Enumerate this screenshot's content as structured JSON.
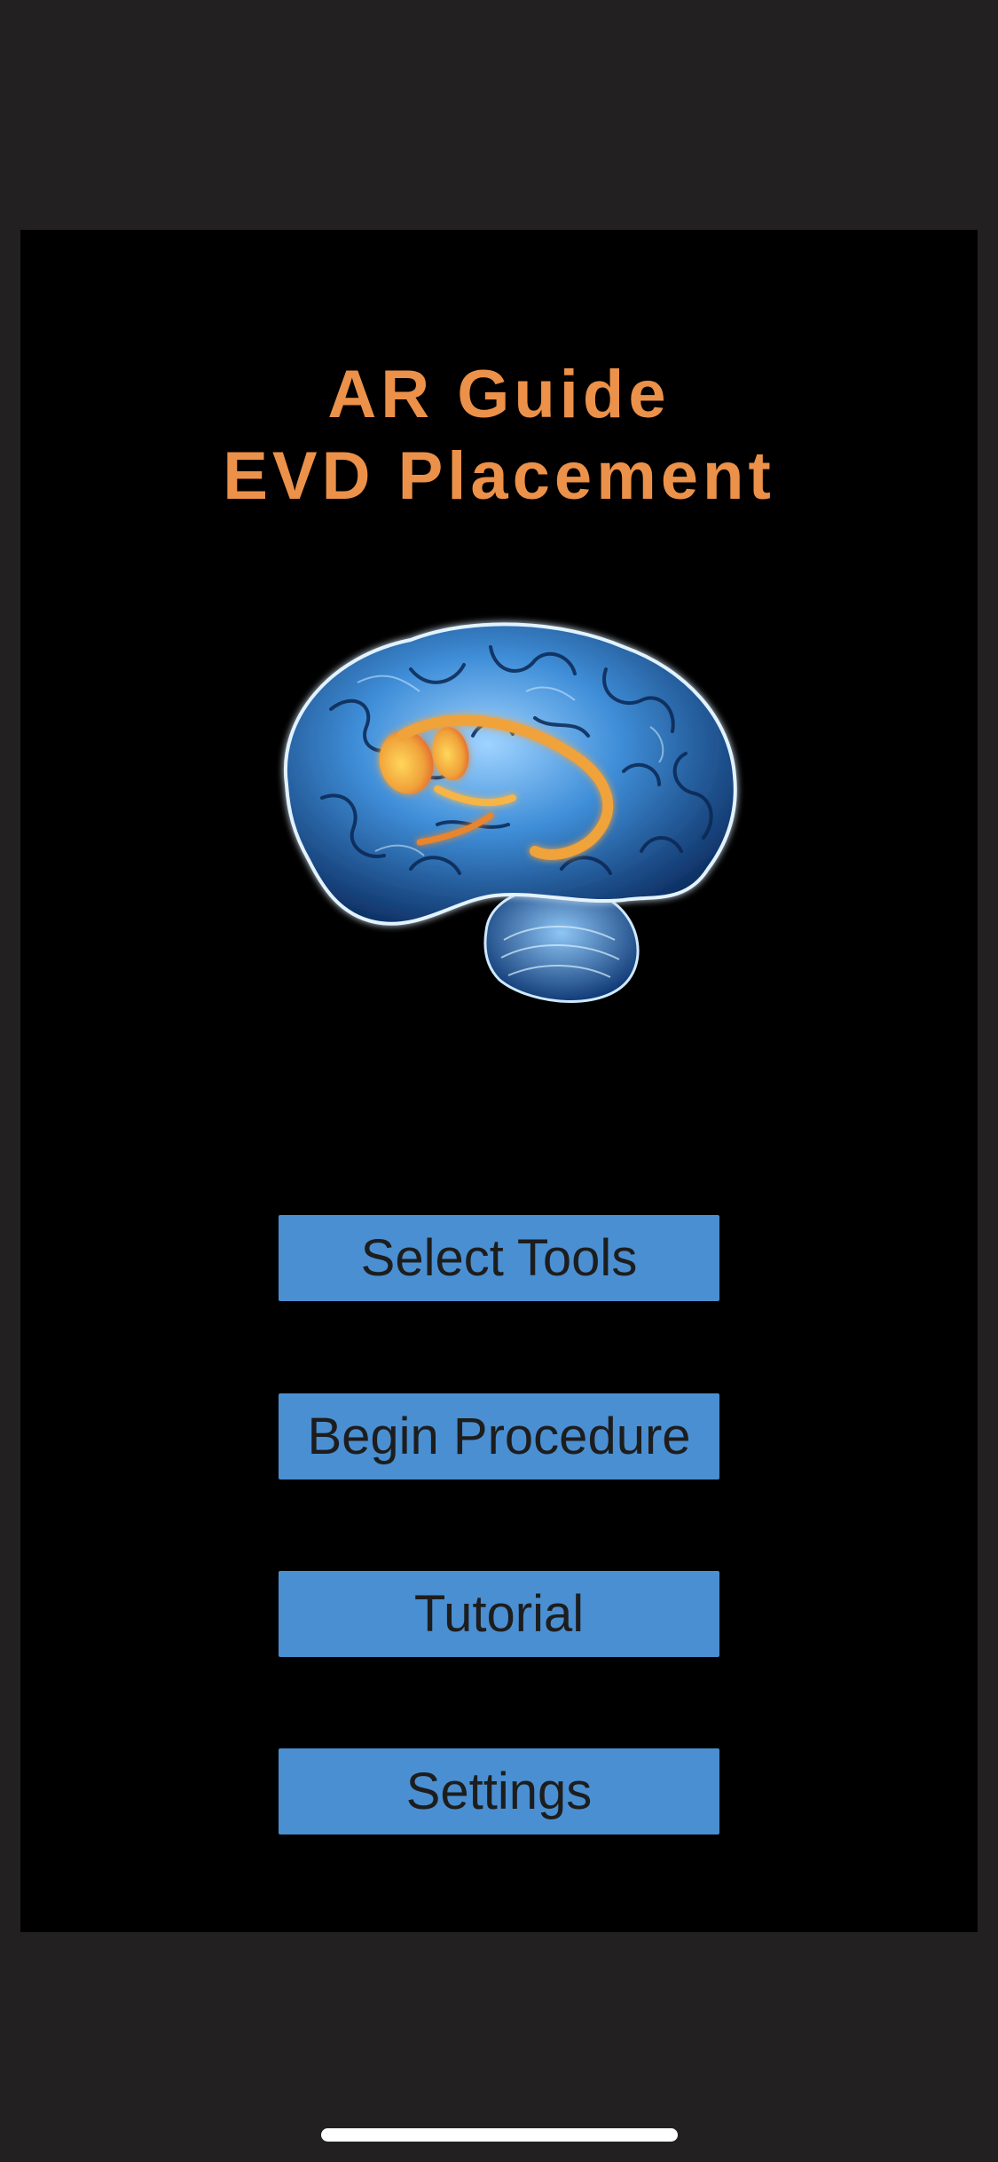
{
  "app": {
    "title_line1": "AR Guide",
    "title_line2": "EVD Placement"
  },
  "hero_image": {
    "icon": "brain-ventricles-icon",
    "brain_color": "#3f8ed8",
    "ventricle_color": "#f0a23a"
  },
  "menu": {
    "select_tools": "Select Tools",
    "begin_procedure": "Begin Procedure",
    "tutorial": "Tutorial",
    "settings": "Settings"
  },
  "colors": {
    "background": "#222021",
    "panel": "#000000",
    "title": "#ec9149",
    "button": "#4a8fd2",
    "button_text": "#1d1d1d"
  }
}
